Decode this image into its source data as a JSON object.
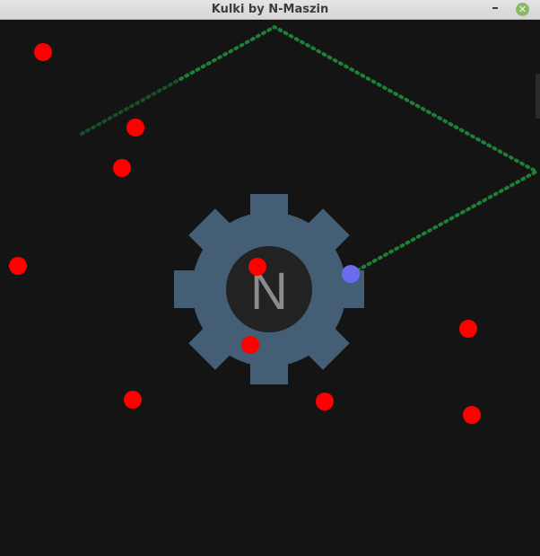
{
  "window": {
    "title": "Kulki by N-Maszin",
    "minimize_icon": "minimize-icon",
    "close_icon": "close-icon",
    "close_glyph": "✕"
  },
  "logo": {
    "letter": "N",
    "gear_color": "#445e75",
    "center_color": "#222222",
    "letter_color": "#8c8c8c"
  },
  "colors": {
    "background": "#141414",
    "ball": "#ff0000",
    "player": "#6b6bf0",
    "trail": "#1e8c3a"
  }
}
